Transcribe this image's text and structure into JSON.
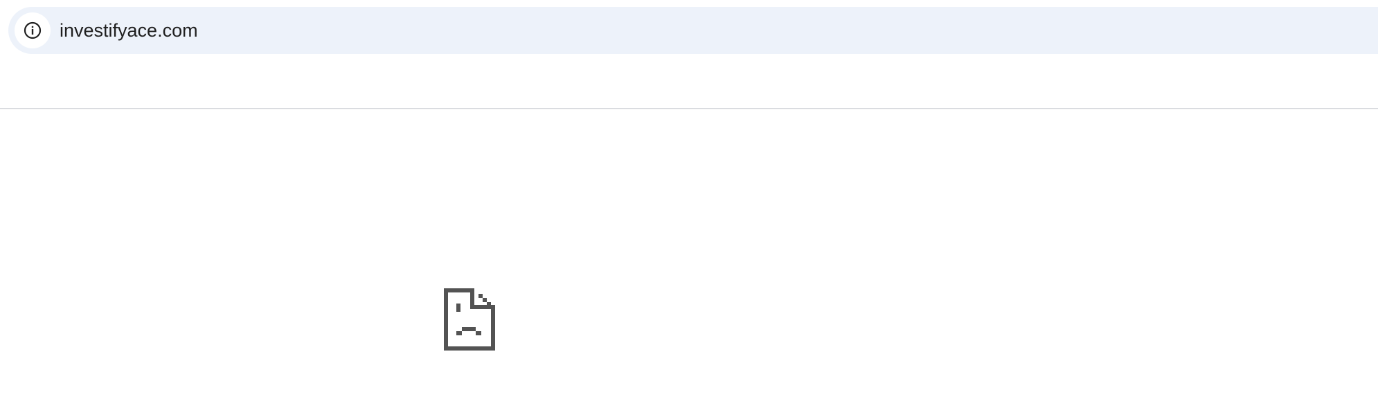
{
  "address_bar": {
    "url": "investifyace.com",
    "site_info_icon": "info-circle-icon"
  },
  "error_page": {
    "icon": "sad-page-icon",
    "icon_color": "#535353"
  },
  "colors": {
    "omnibox_bg": "#edf2fa",
    "divider": "#dadce0",
    "text": "#1f1f1f"
  }
}
